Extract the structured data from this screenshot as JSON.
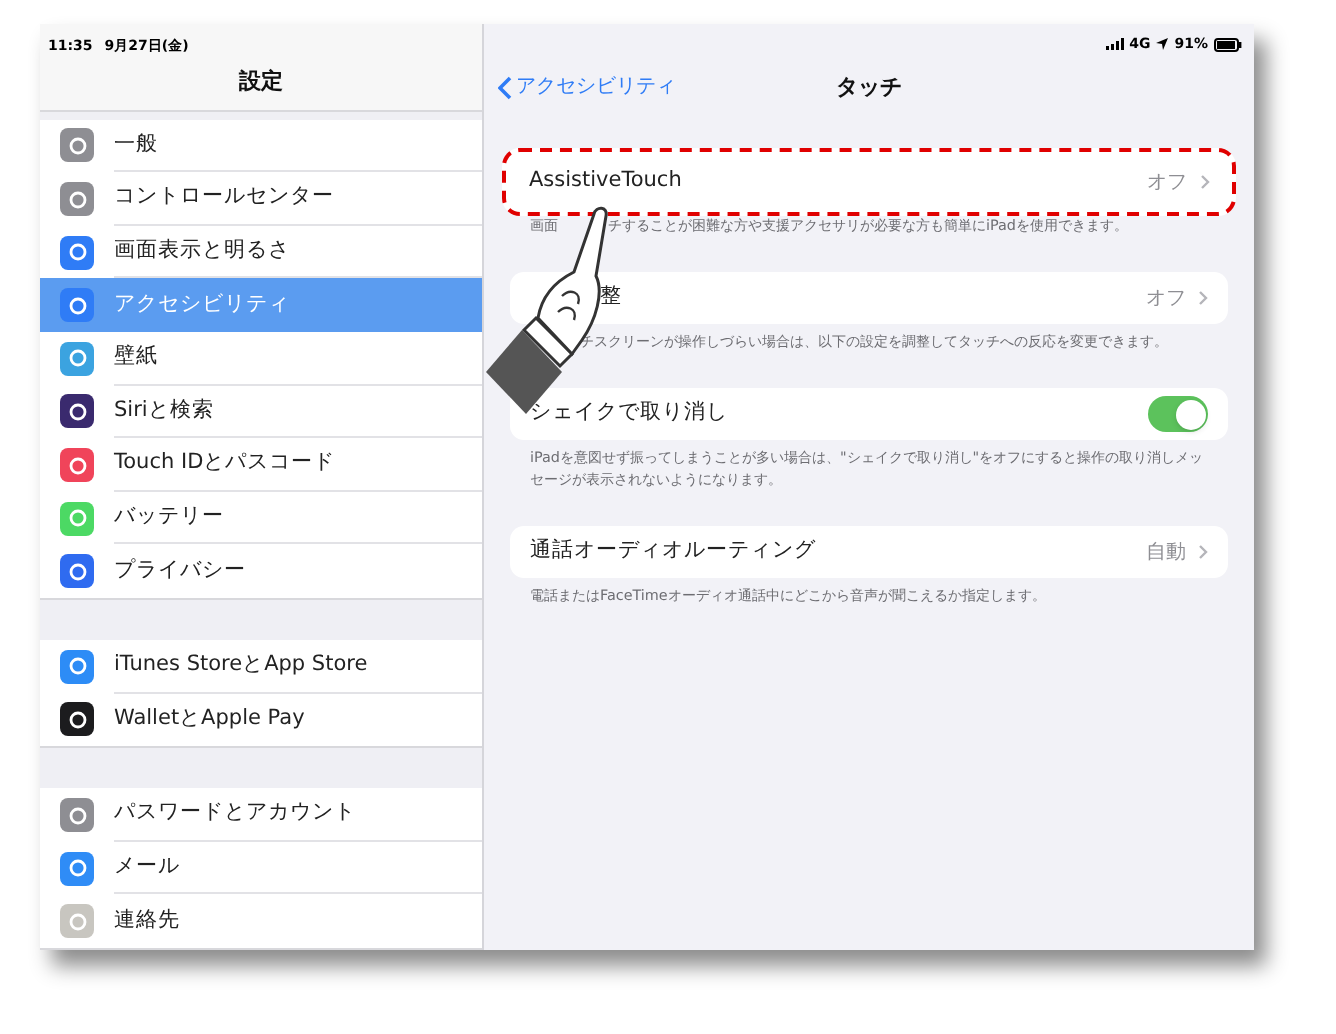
{
  "status_bar": {
    "time": "11:35",
    "date": "9月27日(金)",
    "network": "4G",
    "battery": "91%"
  },
  "sidebar": {
    "title": "設定",
    "groups": [
      [
        {
          "label": "一般",
          "color": "#8e8e93",
          "selected": false
        },
        {
          "label": "コントロールセンター",
          "color": "#8e8e93",
          "selected": false
        },
        {
          "label": "画面表示と明るさ",
          "color": "#2f7cf6",
          "selected": false
        },
        {
          "label": "アクセシビリティ",
          "color": "#2f7cf6",
          "selected": true
        },
        {
          "label": "壁紙",
          "color": "#3ba3e0",
          "selected": false
        },
        {
          "label": "Siriと検索",
          "color": "#3a2a6e",
          "selected": false
        },
        {
          "label": "Touch IDとパスコード",
          "color": "#f0445a",
          "selected": false
        },
        {
          "label": "バッテリー",
          "color": "#4cd964",
          "selected": false
        },
        {
          "label": "プライバシー",
          "color": "#2f6bf0",
          "selected": false
        }
      ],
      [
        {
          "label": "iTunes StoreとApp Store",
          "color": "#2d8cf6",
          "selected": false
        },
        {
          "label": "WalletとApple Pay",
          "color": "#1c1c1e",
          "selected": false
        }
      ],
      [
        {
          "label": "パスワードとアカウント",
          "color": "#8e8e93",
          "selected": false
        },
        {
          "label": "メール",
          "color": "#2f8cf6",
          "selected": false
        },
        {
          "label": "連絡先",
          "color": "#c8c6c0",
          "selected": false
        }
      ]
    ]
  },
  "nav": {
    "back": "アクセシビリティ",
    "title": "タッチ"
  },
  "sections": [
    {
      "kind": "link",
      "label": "AssistiveTouch",
      "value": "オフ",
      "highlighted": true,
      "footer_parts": [
        "画面",
        "チすることが困難な方や支援アクセサリが必要な方も簡単にiPadを使用できます。"
      ]
    },
    {
      "kind": "link",
      "label": "整",
      "value": "オフ",
      "highlighted": false,
      "footer": "チスクリーンが操作しづらい場合は、以下の設定を調整してタッチへの反応を変更できます。"
    },
    {
      "kind": "toggle",
      "label": "シェイクで取り消し",
      "on": true,
      "highlighted": false,
      "footer": "iPadを意図せず振ってしまうことが多い場合は、\"シェイクで取り消し\"をオフにすると操作の取り消しメッセージが表示されないようになります。"
    },
    {
      "kind": "link",
      "label": "通話オーディオルーティング",
      "value": "自動",
      "highlighted": false,
      "footer": "電話またはFaceTimeオーディオ通話中にどこから音声が聞こえるか指定します。"
    }
  ]
}
